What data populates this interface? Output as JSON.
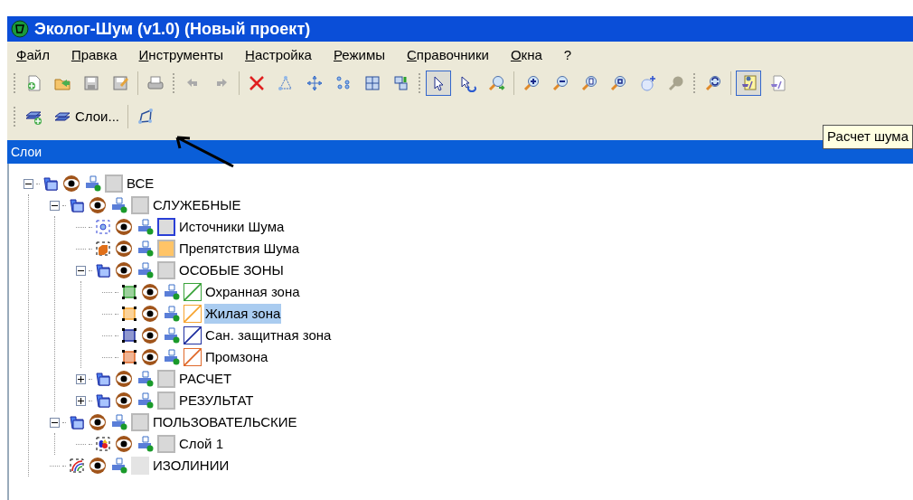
{
  "window": {
    "title": "Эколог-Шум (v1.0) (Новый проект)"
  },
  "menu": [
    "Файл",
    "Правка",
    "Инструменты",
    "Настройка",
    "Режимы",
    "Справочники",
    "Окна",
    "?"
  ],
  "toolbar": [
    [
      {
        "kind": "new",
        "pressed": false
      },
      {
        "kind": "open",
        "pressed": false
      },
      {
        "kind": "save",
        "pressed": false
      },
      {
        "kind": "save-as",
        "pressed": false
      }
    ],
    [
      {
        "kind": "print",
        "pressed": false
      }
    ],
    [
      {
        "kind": "undo",
        "pressed": false
      },
      {
        "kind": "redo",
        "pressed": false
      }
    ],
    [
      {
        "kind": "delete",
        "pressed": false
      },
      {
        "kind": "nodes",
        "pressed": false
      },
      {
        "kind": "move",
        "pressed": false
      },
      {
        "kind": "points",
        "pressed": false
      },
      {
        "kind": "split",
        "pressed": false
      },
      {
        "kind": "group",
        "pressed": false
      }
    ],
    [
      {
        "kind": "pointer",
        "pressed": true
      },
      {
        "kind": "pointer-back",
        "pressed": false
      },
      {
        "kind": "zoom-go",
        "pressed": false
      }
    ],
    [
      {
        "kind": "zoom-in",
        "pressed": false
      },
      {
        "kind": "zoom-out",
        "pressed": false
      },
      {
        "kind": "zoom-page",
        "pressed": false
      },
      {
        "kind": "zoom-window",
        "pressed": false
      },
      {
        "kind": "pan",
        "pressed": false
      },
      {
        "kind": "zoom-off",
        "pressed": false
      }
    ],
    [
      {
        "kind": "refresh",
        "pressed": false
      }
    ],
    [
      {
        "kind": "calc",
        "pressed": true
      },
      {
        "kind": "report",
        "pressed": false
      }
    ]
  ],
  "toolbar2": [
    [
      {
        "kind": "add-layer",
        "pressed": false
      },
      {
        "kind": "layers",
        "label": "Слои...",
        "pressed": false
      }
    ],
    [
      {
        "kind": "polygon",
        "pressed": false
      }
    ]
  ],
  "tooltip": "Расчет шума",
  "panel": {
    "title": "Слои"
  },
  "tree": [
    {
      "label": "ВСЕ",
      "kind": "folder",
      "color": "#d8d8d8",
      "expanded": true,
      "selected": false,
      "children": [
        {
          "label": "СЛУЖЕБНЫЕ",
          "kind": "folder",
          "color": "#d8d8d8",
          "expanded": true,
          "selected": false,
          "children": [
            {
              "label": "Источники Шума",
              "kind": "source",
              "color": "#2a3fd6",
              "selected": false
            },
            {
              "label": "Препятствия Шума",
              "kind": "obstacle",
              "color": "#ffc467",
              "selected": false
            },
            {
              "label": "ОСОБЫЕ ЗОНЫ",
              "kind": "folder",
              "color": "#d8d8d8",
              "expanded": true,
              "selected": false,
              "children": [
                {
                  "label": "Охранная зона",
                  "kind": "zone",
                  "color": "#3aa33a",
                  "selected": false
                },
                {
                  "label": "Жилая зона",
                  "kind": "zone",
                  "color": "#f7a531",
                  "selected": true
                },
                {
                  "label": "Сан. защитная зона",
                  "kind": "zone",
                  "color": "#1f2fa0",
                  "selected": false
                },
                {
                  "label": "Промзона",
                  "kind": "zone",
                  "color": "#e0692a",
                  "selected": false
                }
              ]
            },
            {
              "label": "РАСЧЕТ",
              "kind": "folder",
              "color": "#d8d8d8",
              "expanded": false,
              "selected": false
            },
            {
              "label": "РЕЗУЛЬТАТ",
              "kind": "folder",
              "color": "#d8d8d8",
              "expanded": false,
              "selected": false
            }
          ]
        },
        {
          "label": "ПОЛЬЗОВАТЕЛЬСКИЕ",
          "kind": "folder",
          "color": "#d8d8d8",
          "expanded": true,
          "selected": false,
          "children": [
            {
              "label": "Слой 1",
              "kind": "user",
              "color": "#d8d8d8",
              "selected": false
            }
          ]
        },
        {
          "label": "ИЗОЛИНИИ",
          "kind": "isolines",
          "color": "#e4e4e4",
          "selected": false
        }
      ]
    }
  ]
}
